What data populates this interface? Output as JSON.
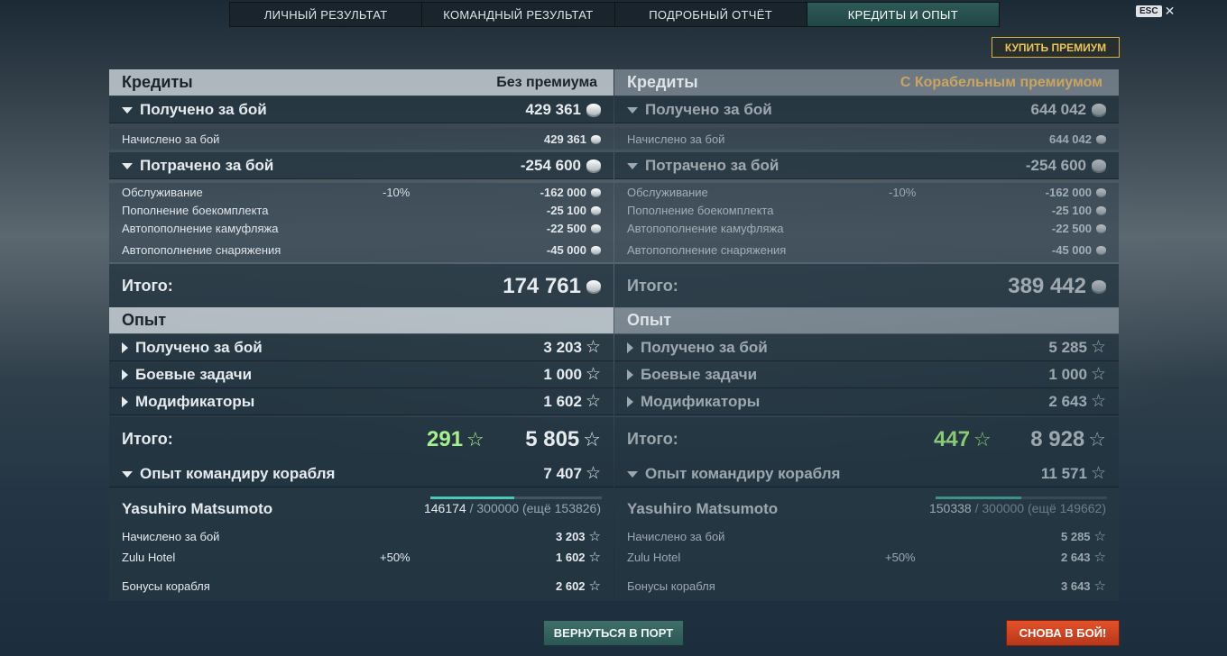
{
  "tabs": [
    {
      "label": "ЛИЧНЫЙ РЕЗУЛЬТАТ",
      "active": false
    },
    {
      "label": "КОМАНДНЫЙ РЕЗУЛЬТАТ",
      "active": false
    },
    {
      "label": "ПОДРОБНЫЙ ОТЧЁТ",
      "active": false
    },
    {
      "label": "КРЕДИТЫ И ОПЫТ",
      "active": true
    }
  ],
  "esc_label": "ESC",
  "close_glyph": "✕",
  "buy_premium_label": "КУПИТЬ ПРЕМИУМ",
  "columns": {
    "left": {
      "credits_header": "Кредиты",
      "account_type": "Без премиума",
      "earned_label": "Получено за бой",
      "earned_value": "429 361",
      "accrued_label": "Начислено за бой",
      "accrued_value": "429 361",
      "spent_label": "Потрачено за бой",
      "spent_value": "-254 600",
      "service_label": "Обслуживание",
      "service_pct": "-10%",
      "service_value": "-162 000",
      "ammo_label": "Пополнение боекомплекта",
      "ammo_value": "-25 100",
      "camo_label": "Автопополнение камуфляжа",
      "camo_value": "-22 500",
      "consumables_label": "Автопополнение снаряжения",
      "consumables_value": "-45 000",
      "credits_total_label": "Итого:",
      "credits_total_value": "174 761",
      "xp_header": "Опыт",
      "xp_battle_label": "Получено за бой",
      "xp_battle_value": "3 203",
      "xp_tasks_label": "Боевые задачи",
      "xp_tasks_value": "1 000",
      "xp_mod_label": "Модификаторы",
      "xp_mod_value": "1 602",
      "xp_total_label": "Итого:",
      "xp_free_value": "291",
      "xp_total_value": "5 805",
      "cmd_xp_label": "Опыт командиру корабля",
      "cmd_xp_value": "7 407",
      "commander_name": "Yasuhiro Matsumoto",
      "cmd_progress_current": "146174",
      "cmd_progress_rest": " / 300000 (ещё 153826)",
      "cmd_progress_fraction": 0.487,
      "cmd_accrued_label": "Начислено за бой",
      "cmd_accrued_value": "3 203",
      "cmd_flag_label": "Zulu Hotel",
      "cmd_flag_pct": "+50%",
      "cmd_flag_value": "1 602",
      "cmd_bonus_label": "Бонусы корабля",
      "cmd_bonus_value": "2 602"
    },
    "right": {
      "credits_header": "Кредиты",
      "account_type": "С Корабельным премиумом",
      "earned_label": "Получено за бой",
      "earned_value": "644 042",
      "accrued_label": "Начислено за бой",
      "accrued_value": "644 042",
      "spent_label": "Потрачено за бой",
      "spent_value": "-254 600",
      "service_label": "Обслуживание",
      "service_pct": "-10%",
      "service_value": "-162 000",
      "ammo_label": "Пополнение боекомплекта",
      "ammo_value": "-25 100",
      "camo_label": "Автопополнение камуфляжа",
      "camo_value": "-22 500",
      "consumables_label": "Автопополнение снаряжения",
      "consumables_value": "-45 000",
      "credits_total_label": "Итого:",
      "credits_total_value": "389 442",
      "xp_header": "Опыт",
      "xp_battle_label": "Получено за бой",
      "xp_battle_value": "5 285",
      "xp_tasks_label": "Боевые задачи",
      "xp_tasks_value": "1 000",
      "xp_mod_label": "Модификаторы",
      "xp_mod_value": "2 643",
      "xp_total_label": "Итого:",
      "xp_free_value": "447",
      "xp_total_value": "8 928",
      "cmd_xp_label": "Опыт командиру корабля",
      "cmd_xp_value": "11 571",
      "commander_name": "Yasuhiro Matsumoto",
      "cmd_progress_current": "150338",
      "cmd_progress_rest": " / 300000 (ещё 149662)",
      "cmd_progress_fraction": 0.501,
      "cmd_accrued_label": "Начислено за бой",
      "cmd_accrued_value": "5 285",
      "cmd_flag_label": "Zulu Hotel",
      "cmd_flag_pct": "+50%",
      "cmd_flag_value": "2 643",
      "cmd_bonus_label": "Бонусы корабля",
      "cmd_bonus_value": "3 643"
    }
  },
  "return_port_label": "ВЕРНУТЬСЯ В ПОРТ",
  "to_battle_label": "СНОВА В БОЙ!",
  "colors": {
    "active_tab": "#2f5a57",
    "premium_gold": "#d8b14a",
    "free_xp_green": "#a8f08e",
    "progress_teal": "#4fc7b7",
    "battle_button": "#d2451f"
  }
}
